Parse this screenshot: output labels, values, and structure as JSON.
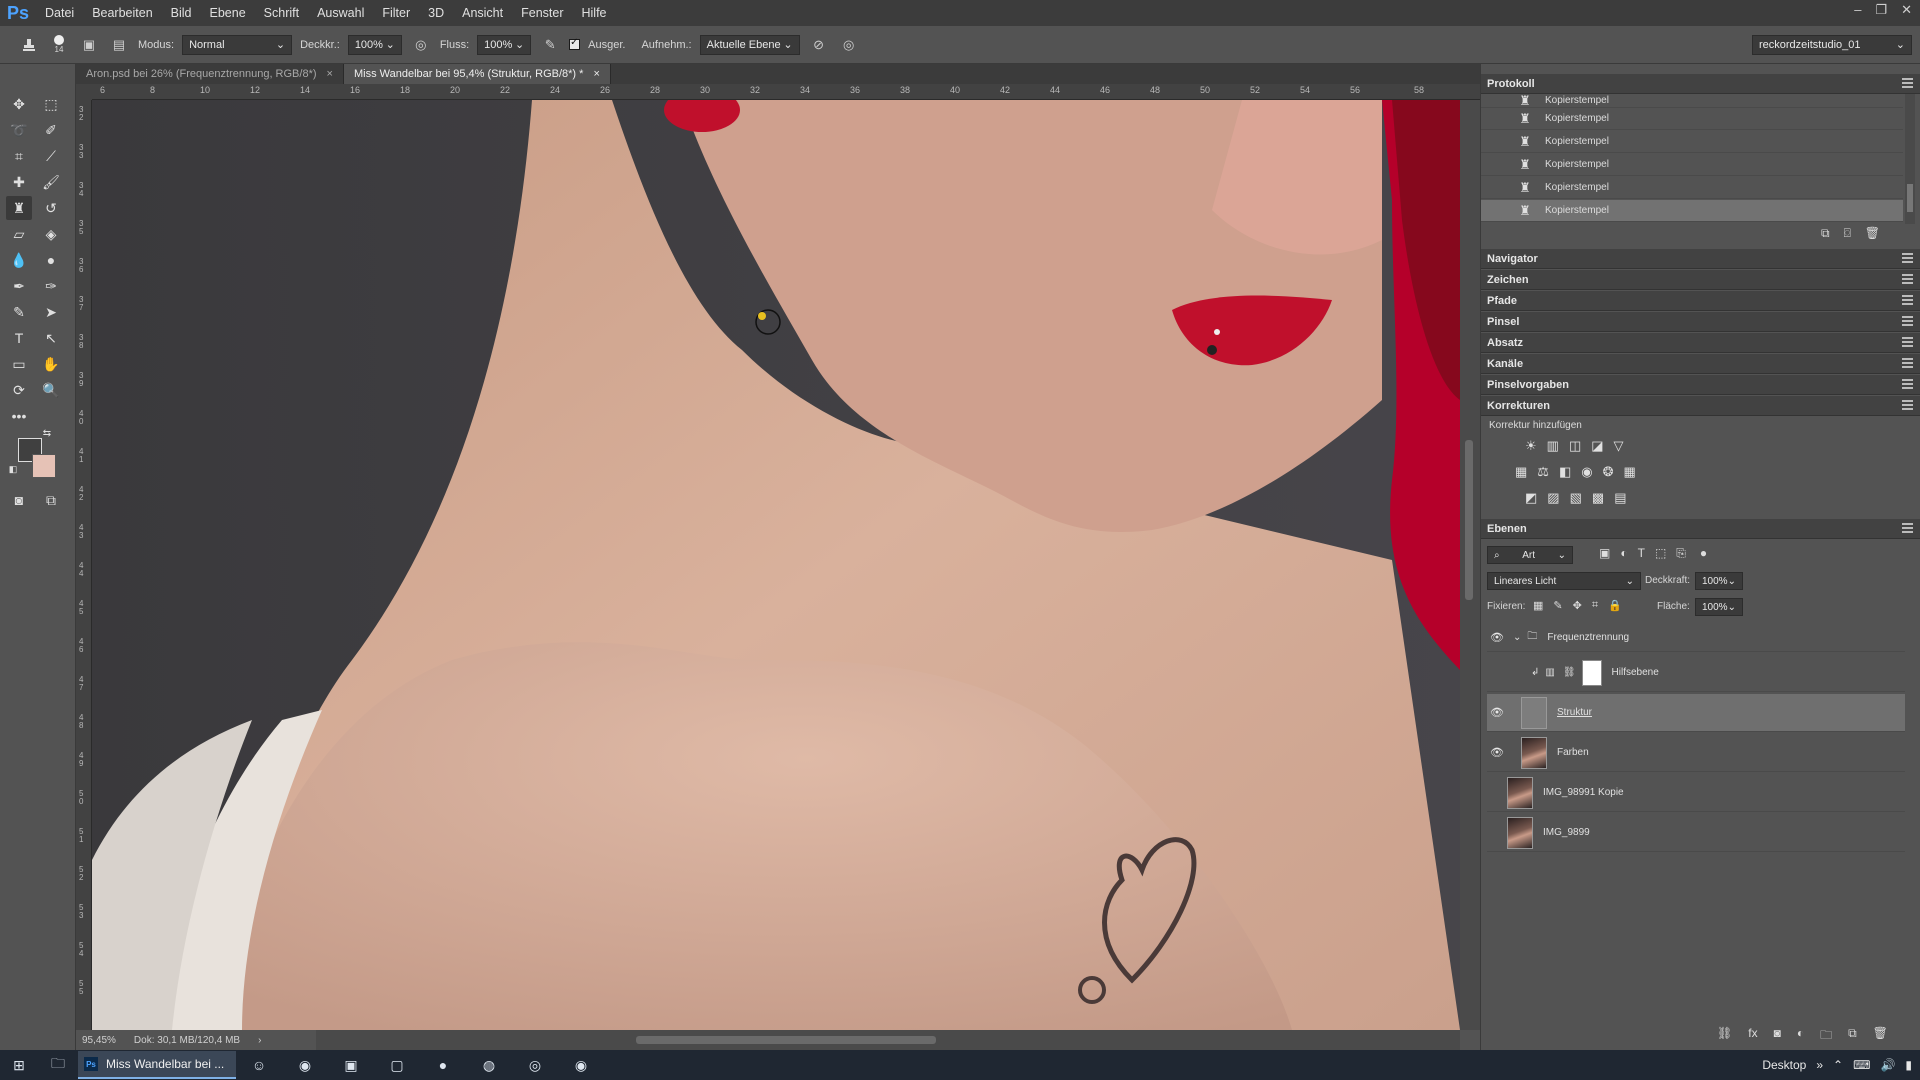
{
  "app": {
    "logo": "Ps"
  },
  "menu": [
    "Datei",
    "Bearbeiten",
    "Bild",
    "Ebene",
    "Schrift",
    "Auswahl",
    "Filter",
    "3D",
    "Ansicht",
    "Fenster",
    "Hilfe"
  ],
  "window_controls": [
    "–",
    "❐",
    "✕"
  ],
  "options": {
    "brush_size": "14",
    "modus_label": "Modus:",
    "modus_value": "Normal",
    "deckkr_label": "Deckkr.:",
    "deckkr_value": "100%",
    "fluss_label": "Fluss:",
    "fluss_value": "100%",
    "ausger_label": "Ausger.",
    "aufnehm_label": "Aufnehm.:",
    "aufnehm_value": "Aktuelle Ebene",
    "workspace_value": "reckordzeitstudio_01"
  },
  "tabs": [
    {
      "label": "Aron.psd bei 26% (Frequenztrennung, RGB/8*)",
      "close": "×"
    },
    {
      "label": "Miss Wandelbar bei 95,4% (Struktur, RGB/8*) *",
      "close": "×"
    }
  ],
  "ruler_top": [
    "6",
    "8",
    "10",
    "12",
    "14",
    "16",
    "18",
    "20",
    "22",
    "24",
    "26",
    "28",
    "30",
    "32",
    "34",
    "36",
    "38",
    "40",
    "42",
    "44",
    "46",
    "48",
    "50",
    "52",
    "54",
    "56",
    "58"
  ],
  "ruler_left": [
    "3 2",
    "3 3",
    "3 4",
    "3 5",
    "3 6",
    "3 7",
    "3 8",
    "3 9",
    "4 0",
    "4 1",
    "4 2",
    "4 3",
    "4 4",
    "4 5",
    "4 6",
    "4 7",
    "4 8",
    "4 9",
    "5 0",
    "5 1",
    "5 2",
    "5 3",
    "5 4",
    "5 5"
  ],
  "status": {
    "zoom": "95,45%",
    "doc": "Dok: 30,1 MB/120,4 MB",
    "arrow": "›"
  },
  "panels": {
    "protokoll": {
      "title": "Protokoll",
      "items": [
        "Kopierstempel",
        "Kopierstempel",
        "Kopierstempel",
        "Kopierstempel",
        "Kopierstempel",
        "Kopierstempel"
      ]
    },
    "collapsed": [
      "Navigator",
      "Zeichen",
      "Pfade",
      "Pinsel",
      "Absatz",
      "Kanäle",
      "Pinselvorgaben"
    ],
    "korrekturen": {
      "title": "Korrekturen",
      "subtitle": "Korrektur hinzufügen"
    },
    "ebenen": {
      "title": "Ebenen",
      "filter_value": "Art",
      "blend_value": "Lineares Licht",
      "deckkraft_label": "Deckkraft:",
      "deckkraft_value": "100%",
      "fixieren_label": "Fixieren:",
      "flaeche_label": "Fläche:",
      "flaeche_value": "100%",
      "layers": [
        {
          "name": "Frequenztrennung",
          "visible": true,
          "type": "group"
        },
        {
          "name": "Hilfsebene",
          "visible": false,
          "type": "adjustment"
        },
        {
          "name": "Struktur",
          "visible": true,
          "type": "gray",
          "active": true
        },
        {
          "name": "Farben",
          "visible": true,
          "type": "photo"
        },
        {
          "name": "IMG_98991 Kopie",
          "visible": false,
          "type": "photo"
        },
        {
          "name": "IMG_9899",
          "visible": false,
          "type": "photo"
        }
      ]
    }
  },
  "taskbar": {
    "active_task": "Miss Wandelbar bei ...",
    "tray_label": "Desktop"
  },
  "colors": {
    "foreground": "#404040",
    "background": "#e6c2b6",
    "accent_lip": "#c0102c",
    "hair": "#b5002a"
  }
}
